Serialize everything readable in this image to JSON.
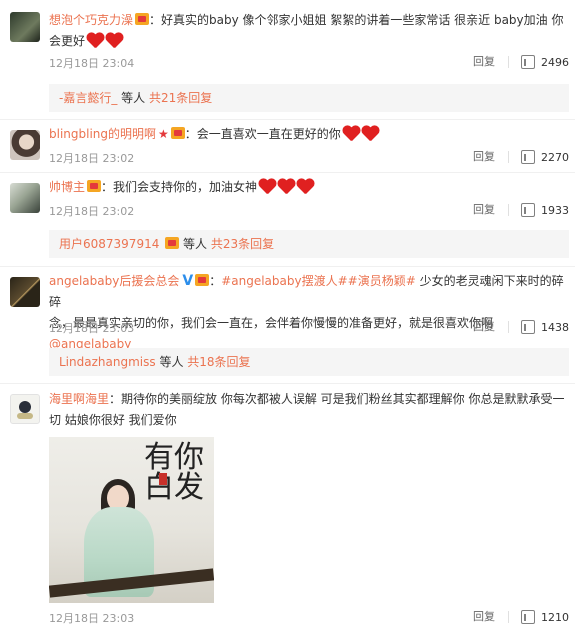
{
  "comments": [
    {
      "user": "想泡个巧克力澡",
      "text": "：好真实的baby 像个邻家小姐姐 絮絮的讲着一些家常话 很亲近 baby加油 你会更好",
      "hearts": 2,
      "time": "12月18日 23:04",
      "reply_label": "回复",
      "likes": "2496",
      "sub": {
        "user": "-嘉言懿行_",
        "middle": "等人",
        "count": "共21条回复"
      }
    },
    {
      "user": "blingbling的明明啊",
      "text": "：会一直喜欢一直在更好的你",
      "hearts": 2,
      "time": "12月18日 23:02",
      "reply_label": "回复",
      "likes": "2270"
    },
    {
      "user": "帅博主",
      "text": "：我们会支持你的，加油女神",
      "hearts": 3,
      "time": "12月18日 23:02",
      "reply_label": "回复",
      "likes": "1933",
      "sub": {
        "user": "用户6087397914",
        "middle": "等人",
        "count": "共23条回复"
      }
    },
    {
      "user": "angelababy后援会总会",
      "tag1": "#angelababy摆渡人#",
      "tag2": "#演员杨颖#",
      "text_line1": " 少女的老灵魂闲下来时的碎碎",
      "text_line2a": "念，最最真实亲切的你，我们会一直在，会伴着你慢慢的准备更好，就是很喜欢你啊",
      "mention": "@angelababy",
      "time": "12月18日 23:03",
      "reply_label": "回复",
      "likes": "1438",
      "sub": {
        "user": "Lindazhangmiss",
        "middle": "等人",
        "count": "共18条回复"
      }
    },
    {
      "user": "海里啊海里",
      "text_line1": "：期待你的美丽绽放 你每次都被人误解 可是我们粉丝其实都理解你 你总是默默承受一",
      "text_line2": "切 姑娘你很好 我们爱你",
      "time": "12月18日 23:03",
      "reply_label": "回复",
      "likes": "1210"
    }
  ],
  "photo_calligraphy": "有你白发"
}
